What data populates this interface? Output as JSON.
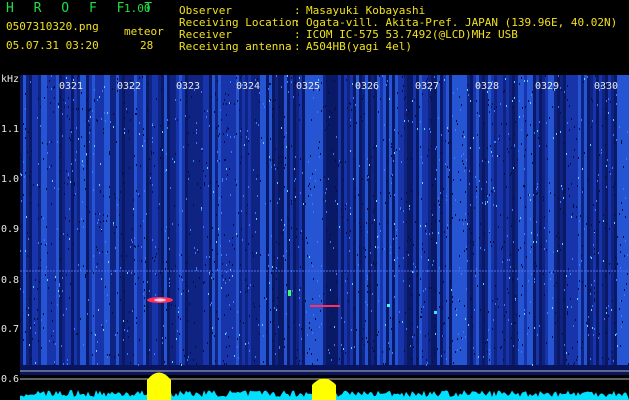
{
  "header": {
    "app_title": "H R O F F T",
    "version": "1.00",
    "filename": "0507310320.png",
    "datetime": "05.07.31 03:20",
    "meteor_label": "meteor",
    "meteor_count": "28"
  },
  "info": {
    "observer_label": "Observer",
    "observer_value": "Masayuki Kobayashi",
    "location_label": "Receiving Location",
    "location_value": "Ogata-vill. Akita-Pref. JAPAN (139.96E, 40.02N)",
    "receiver_label": "Receiver",
    "receiver_value": "ICOM IC-575 53.7492(@LCD)MHz USB",
    "antenna_label": "Receiving antenna",
    "antenna_value": "A504HB(yagi 4el)",
    "colon": ":"
  },
  "axis": {
    "unit": "kHz",
    "y_labels": [
      "1.1",
      "1.0",
      "0.9",
      "0.8",
      "0.7",
      "0.6"
    ],
    "time_ticks": [
      "0321",
      "0322",
      "0323",
      "0324",
      "0325",
      "0326",
      "0327",
      "0328",
      "0329",
      "0330"
    ]
  },
  "colors": {
    "text_green": "#22dd44",
    "text_white": "#e8e8e8",
    "text_yellow": "#f0e020",
    "background": "#000000",
    "spectrogram_base": "#0a1a6e",
    "meteor_echo": "#ff3060",
    "signal_level": "#00e0ff",
    "peak_level": "#ffff00"
  }
}
